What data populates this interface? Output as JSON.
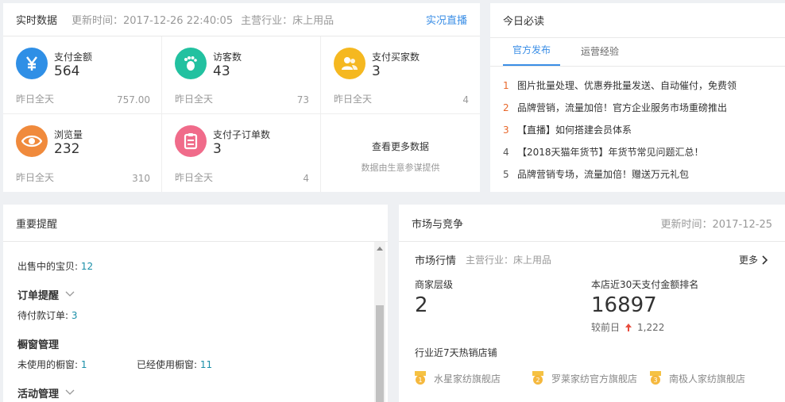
{
  "realtime": {
    "title": "实时数据",
    "update_label": "更新时间：2017-12-26 22:40:05",
    "industry_label": "主营行业：床上用品",
    "live_link": "实况直播",
    "cells": [
      {
        "label": "支付金额",
        "value": "564",
        "yesterday_label": "昨日全天",
        "yesterday_value": "757.00",
        "icon": "yen-icon",
        "color": "#2f8fe6"
      },
      {
        "label": "访客数",
        "value": "43",
        "yesterday_label": "昨日全天",
        "yesterday_value": "73",
        "icon": "footprint-icon",
        "color": "#22c1a0"
      },
      {
        "label": "支付买家数",
        "value": "3",
        "yesterday_label": "昨日全天",
        "yesterday_value": "4",
        "icon": "users-icon",
        "color": "#f5b820"
      },
      {
        "label": "浏览量",
        "value": "232",
        "yesterday_label": "昨日全天",
        "yesterday_value": "310",
        "icon": "eye-icon",
        "color": "#f08a3c"
      },
      {
        "label": "支付子订单数",
        "value": "3",
        "yesterday_label": "昨日全天",
        "yesterday_value": "4",
        "icon": "clipboard-icon",
        "color": "#f06b8a"
      }
    ],
    "more_data": "查看更多数据",
    "more_source": "数据由生意参谋提供"
  },
  "reads": {
    "title": "今日必读",
    "tabs": [
      "官方发布",
      "运营经验"
    ],
    "items": [
      {
        "n": "1",
        "text": "图片批量处理、优惠券批量发送、自动催付，免费领"
      },
      {
        "n": "2",
        "text": "品牌营销，流量加倍！官方企业服务市场重磅推出"
      },
      {
        "n": "3",
        "text": "【直播】如何搭建会员体系"
      },
      {
        "n": "4",
        "text": "【2018天猫年货节】年货节常见问题汇总！"
      },
      {
        "n": "5",
        "text": "品牌营销专场，流量加倍！赠送万元礼包"
      }
    ]
  },
  "reminders": {
    "title": "重要提醒",
    "on_sale_label": "出售中的宝贝:",
    "on_sale_value": "12",
    "order_title": "订单提醒",
    "pending_label": "待付款订单:",
    "pending_value": "3",
    "window_title": "橱窗管理",
    "unused_label": "未使用的橱窗:",
    "unused_value": "1",
    "used_label": "已经使用橱窗:",
    "used_value": "11",
    "activity_title": "活动管理"
  },
  "market": {
    "title": "市场与竞争",
    "update_label": "更新时间：2017-12-25",
    "sub_title": "市场行情",
    "sub_industry": "主营行业：床上用品",
    "more": "更多",
    "level_label": "商家层级",
    "level_value": "2",
    "rank_label": "本店近30天支付金额排名",
    "rank_value": "16897",
    "compare_label": "较前日",
    "compare_value": "1,222",
    "hot_title": "行业近7天热销店铺",
    "shops": [
      {
        "rank": "1",
        "name": "水星家纺旗舰店"
      },
      {
        "rank": "2",
        "name": "罗莱家纺官方旗舰店"
      },
      {
        "rank": "3",
        "name": "南极人家纺旗舰店"
      }
    ]
  }
}
